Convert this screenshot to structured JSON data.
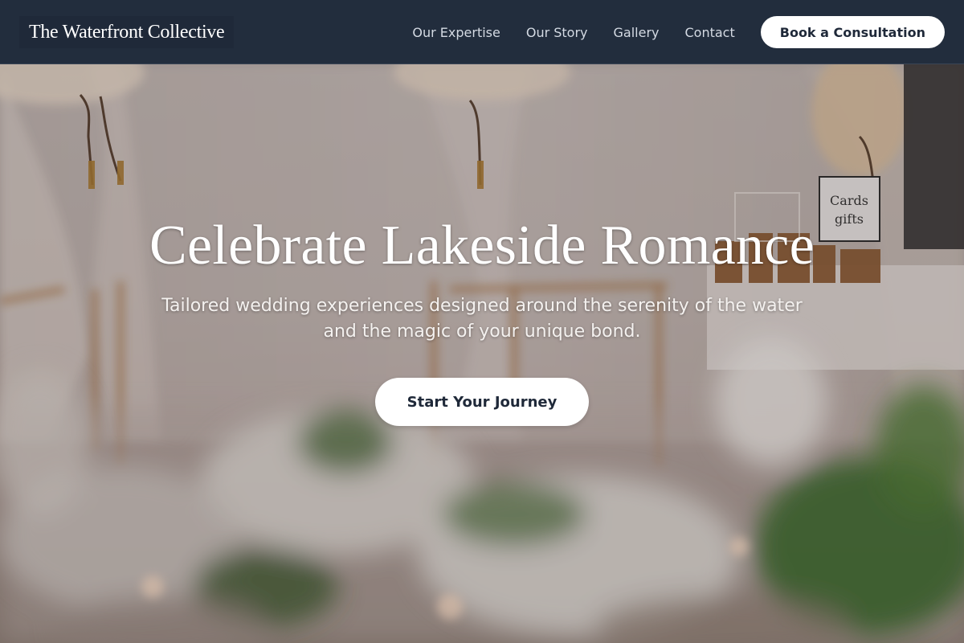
{
  "header": {
    "brand": "The Waterfront Collective",
    "nav": [
      {
        "label": "Our Expertise"
      },
      {
        "label": "Our Story"
      },
      {
        "label": "Gallery"
      },
      {
        "label": "Contact"
      }
    ],
    "cta_label": "Book a Consultation"
  },
  "hero": {
    "title": "Celebrate Lakeside Romance",
    "subtitle": "Tailored wedding experiences designed around the serenity of the water and the magic of your unique bond.",
    "button_label": "Start Your Journey"
  },
  "colors": {
    "header_bg": "#222d3d",
    "brand_text": "#ffffff",
    "nav_text": "#d4dae3",
    "button_bg": "#ffffff",
    "button_text": "#1f2939"
  }
}
